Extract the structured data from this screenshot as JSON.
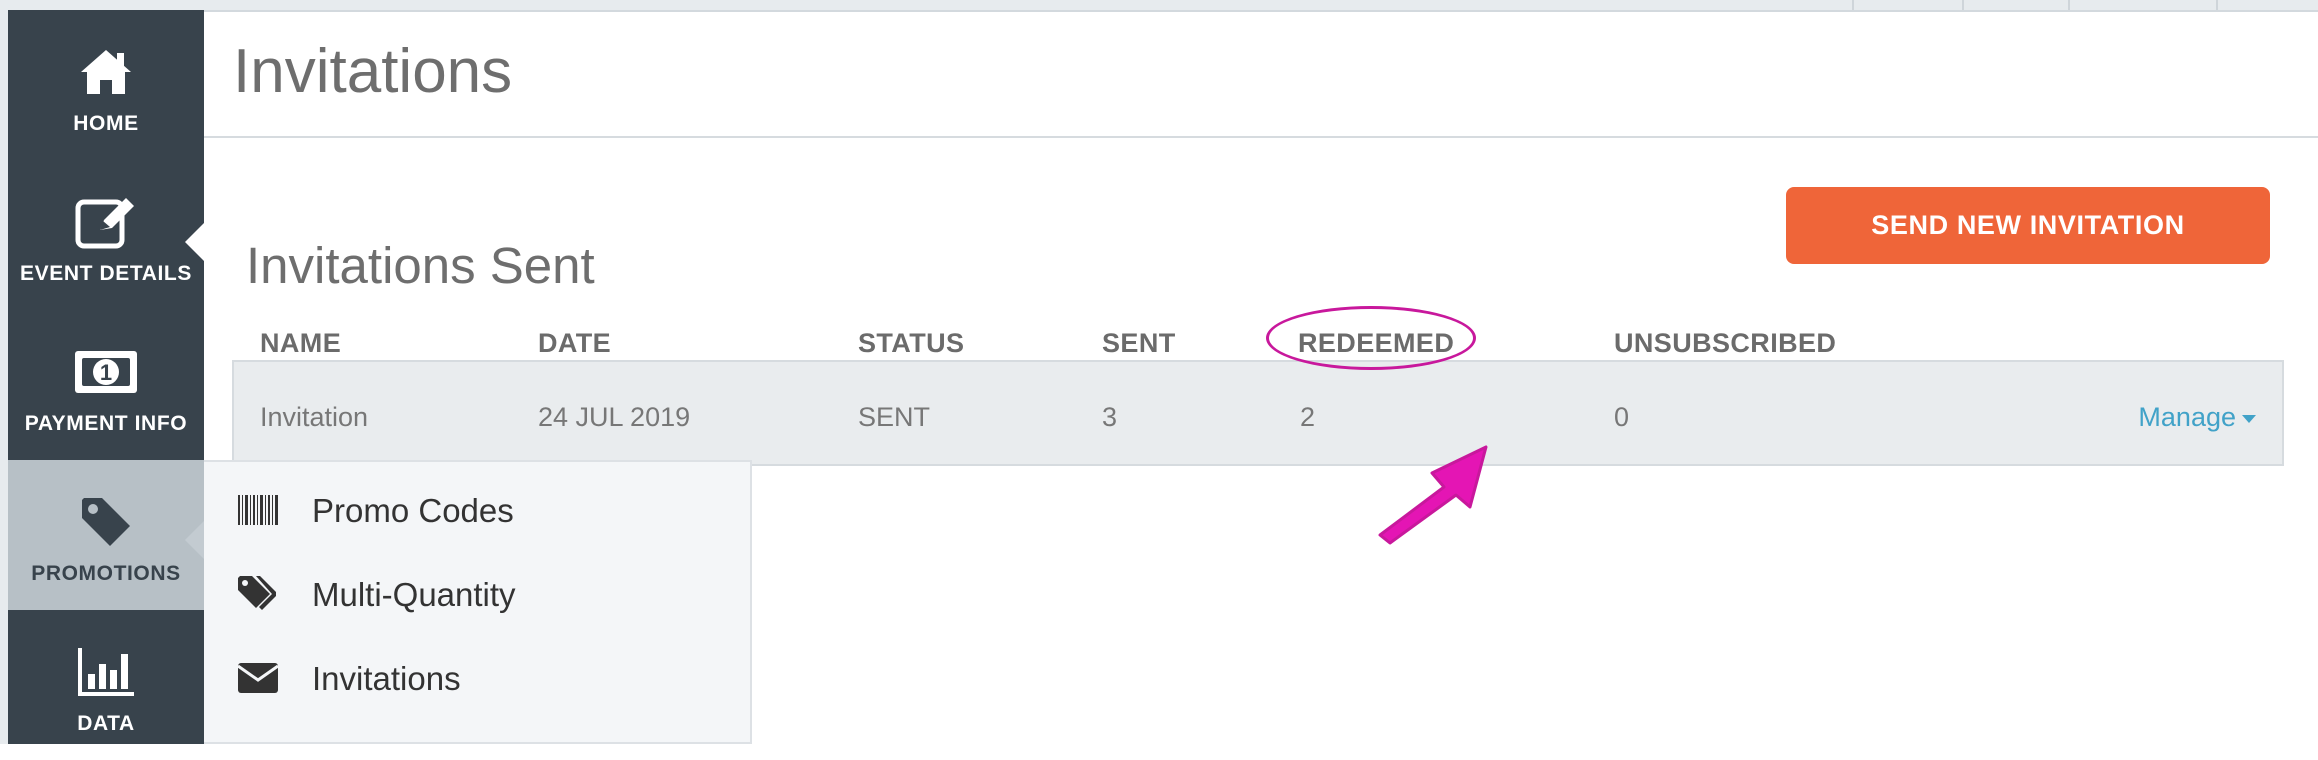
{
  "sidebar": {
    "items": [
      {
        "label": "HOME",
        "icon": "home-icon",
        "active": false
      },
      {
        "label": "EVENT DETAILS",
        "icon": "edit-icon",
        "active": false
      },
      {
        "label": "PAYMENT INFO",
        "icon": "money-icon",
        "active": false
      },
      {
        "label": "PROMOTIONS",
        "icon": "tag-icon",
        "active": true
      },
      {
        "label": "DATA",
        "icon": "bar-chart-icon",
        "active": false
      }
    ]
  },
  "page": {
    "title": "Invitations"
  },
  "toolbar": {
    "send_label": "SEND NEW INVITATION"
  },
  "invitations": {
    "section_title": "Invitations Sent",
    "columns": [
      "NAME",
      "DATE",
      "STATUS",
      "SENT",
      "REDEEMED",
      "UNSUBSCRIBED"
    ],
    "rows": [
      {
        "name": "Invitation",
        "date": "24 JUL 2019",
        "status": "SENT",
        "sent": "3",
        "redeemed": "2",
        "unsubscribed": "0",
        "action": "Manage"
      }
    ]
  },
  "promotions_menu": {
    "items": [
      {
        "label": "Promo Codes",
        "icon": "barcode-icon"
      },
      {
        "label": "Multi-Quantity",
        "icon": "tags-icon"
      },
      {
        "label": "Invitations",
        "icon": "envelope-icon"
      }
    ]
  },
  "colors": {
    "accent": "#ef6539",
    "link": "#41a2c8",
    "sidebar": "#38434c",
    "annotation": "#c8189c"
  }
}
